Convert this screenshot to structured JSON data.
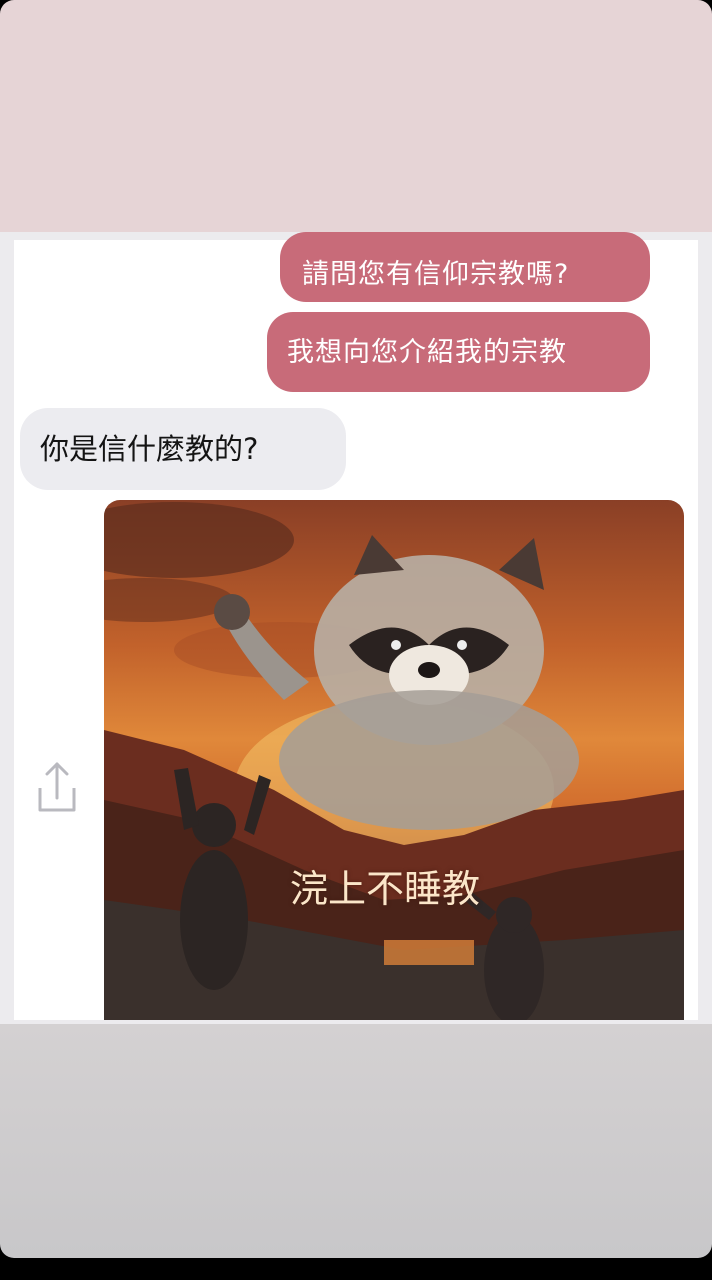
{
  "chat": {
    "messages": [
      {
        "direction": "outgoing",
        "text": "請問您有信仰宗教嗎?"
      },
      {
        "direction": "outgoing",
        "text": "我想向您介紹我的宗教"
      },
      {
        "direction": "incoming",
        "text": "你是信什麼教的?"
      }
    ],
    "image_caption": "浣上不睡教"
  },
  "icons": {
    "share": "share-icon"
  },
  "colors": {
    "outgoing_bubble": "#c86b79",
    "incoming_bubble": "#ececf0",
    "top_band": "#e6d4d6",
    "bottom_band": "#cfcccd"
  }
}
